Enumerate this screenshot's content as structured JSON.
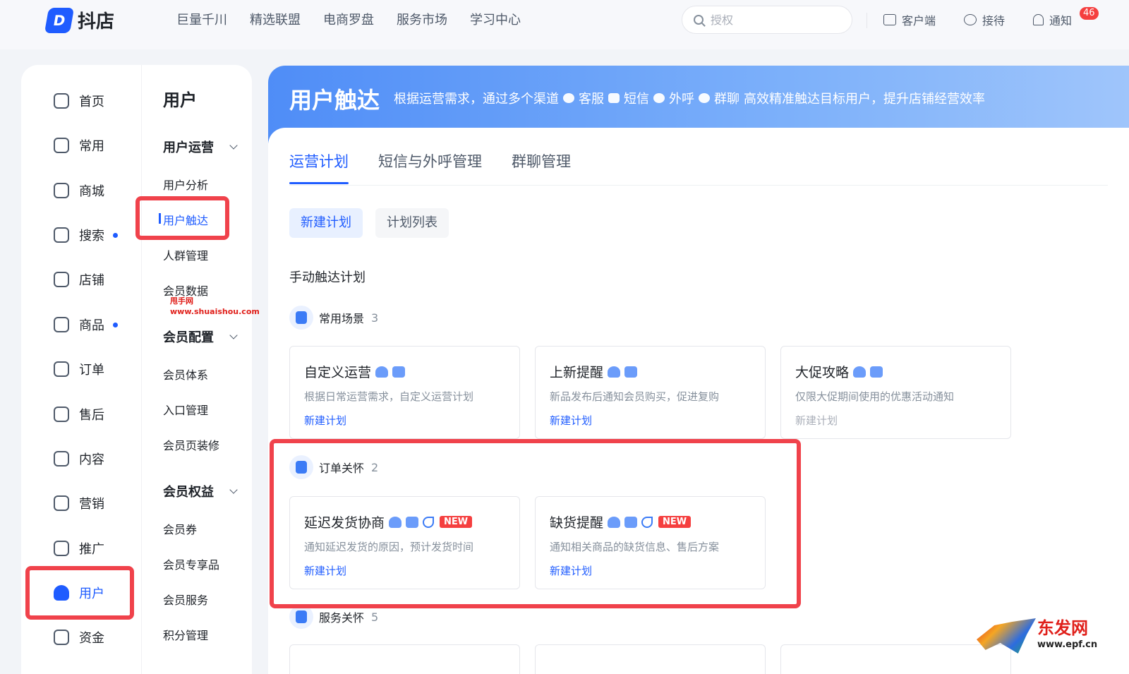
{
  "header": {
    "logo_text": "抖店",
    "nav": [
      "巨量千川",
      "精选联盟",
      "电商罗盘",
      "服务市场",
      "学习中心"
    ],
    "search_placeholder": "授权",
    "actions": {
      "client": "客户端",
      "reception": "接待",
      "notice": "通知",
      "notice_count": "46"
    }
  },
  "sidebar": {
    "items": [
      {
        "label": "首页",
        "icon": "home-icon",
        "dot": false
      },
      {
        "label": "常用",
        "icon": "folder-icon",
        "dot": false
      },
      {
        "label": "商城",
        "icon": "shop-icon",
        "dot": false
      },
      {
        "label": "搜索",
        "icon": "search-chart-icon",
        "dot": true
      },
      {
        "label": "店铺",
        "icon": "store-icon",
        "dot": false
      },
      {
        "label": "商品",
        "icon": "bag-icon",
        "dot": true
      },
      {
        "label": "订单",
        "icon": "order-icon",
        "dot": false
      },
      {
        "label": "售后",
        "icon": "aftersale-icon",
        "dot": false
      },
      {
        "label": "内容",
        "icon": "tv-icon",
        "dot": false
      },
      {
        "label": "营销",
        "icon": "megaphone-icon",
        "dot": false
      },
      {
        "label": "推广",
        "icon": "promote-icon",
        "dot": false
      },
      {
        "label": "用户",
        "icon": "user-icon",
        "dot": false,
        "active": true
      },
      {
        "label": "资金",
        "icon": "wallet-icon",
        "dot": false
      }
    ]
  },
  "submenu": {
    "title": "用户",
    "group_ops": "用户运营",
    "ops_items": [
      "用户分析",
      "用户触达",
      "人群管理",
      "会员数据"
    ],
    "group_config": "会员配置",
    "config_items": [
      "会员体系",
      "入口管理",
      "会员页装修"
    ],
    "group_rights": "会员权益",
    "rights_items": [
      "会员券",
      "会员专享品",
      "会员服务",
      "积分管理"
    ],
    "watermark_line1": "甩手网",
    "watermark_line2": "www.shuaishou.com"
  },
  "banner": {
    "title": "用户触达",
    "desc_prefix": "根据运营需求，通过多个渠道",
    "channels": [
      "客服",
      "短信",
      "外呼",
      "群聊"
    ],
    "desc_suffix": "高效精准触达目标用户，提升店铺经营效率"
  },
  "tabs": [
    "运营计划",
    "短信与外呼管理",
    "群聊管理"
  ],
  "segments": [
    "新建计划",
    "计划列表"
  ],
  "section_title": "手动触达计划",
  "groups": [
    {
      "name": "常用场景",
      "count": "3"
    },
    {
      "name": "订单关怀",
      "count": "2"
    },
    {
      "name": "服务关怀",
      "count": "5"
    }
  ],
  "cards_common": [
    {
      "title": "自定义运营",
      "desc": "根据日常运营需求，自定义运营计划",
      "link": "新建计划"
    },
    {
      "title": "上新提醒",
      "desc": "新品发布后通知会员购买，促进复购",
      "link": "新建计划"
    },
    {
      "title": "大促攻略",
      "desc": "仅限大促期间使用的优惠活动通知",
      "link": "新建计划"
    }
  ],
  "cards_order": [
    {
      "title": "延迟发货协商",
      "badge": "NEW",
      "desc": "通知延迟发货的原因，预计发货时间",
      "link": "新建计划"
    },
    {
      "title": "缺货提醒",
      "badge": "NEW",
      "desc": "通知相关商品的缺货信息、售后方案",
      "link": "新建计划"
    }
  ],
  "corner_logo": {
    "text": "东发网",
    "url": "www.epf.cn"
  },
  "colors": {
    "accent": "#1f5cff",
    "highlight": "#f0424b",
    "badge": "#f53f3f"
  }
}
